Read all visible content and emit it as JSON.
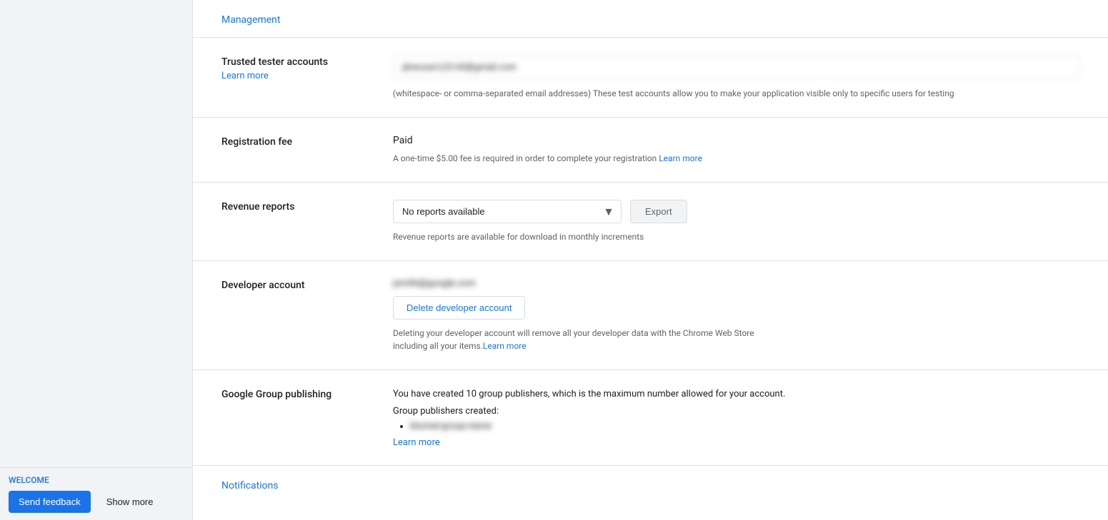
{
  "leftPanel": {
    "welcomeText": "WELCOME",
    "sendFeedbackLabel": "Send feedback",
    "showMoreLabel": "Show more"
  },
  "managementLink": "Management",
  "sections": {
    "trustedTesterAccounts": {
      "label": "Trusted tester accounts",
      "learnMoreLabel": "Learn more",
      "emailPlaceholder": "blurred@gmail.com",
      "hintText": "(whitespace- or comma-separated email addresses) These test accounts allow you to make your application visible only to specific users for testing"
    },
    "registrationFee": {
      "label": "Registration fee",
      "status": "Paid",
      "description": "A one-time $5.00 fee is required in order to complete your registration",
      "learnMoreLabel": "Learn more"
    },
    "revenueReports": {
      "label": "Revenue reports",
      "dropdownValue": "No reports available",
      "exportLabel": "Export",
      "hintText": "Revenue reports are available for download in monthly increments"
    },
    "developerAccount": {
      "label": "Developer account",
      "accountEmail": "blurred@google.com",
      "deleteButtonLabel": "Delete developer account",
      "deleteDescription": "Deleting your developer account will remove all your developer data with the Chrome Web Store including all your items.",
      "deleteLearnMoreLabel": "Learn more"
    },
    "googleGroupPublishing": {
      "label": "Google Group publishing",
      "description": "You have created 10 group publishers, which is the maximum number allowed for your account.",
      "groupsCreatedLabel": "Group publishers created:",
      "groups": [
        "blurred-group"
      ],
      "learnMoreLabel": "Learn more"
    }
  },
  "notificationsLink": "Notifications"
}
